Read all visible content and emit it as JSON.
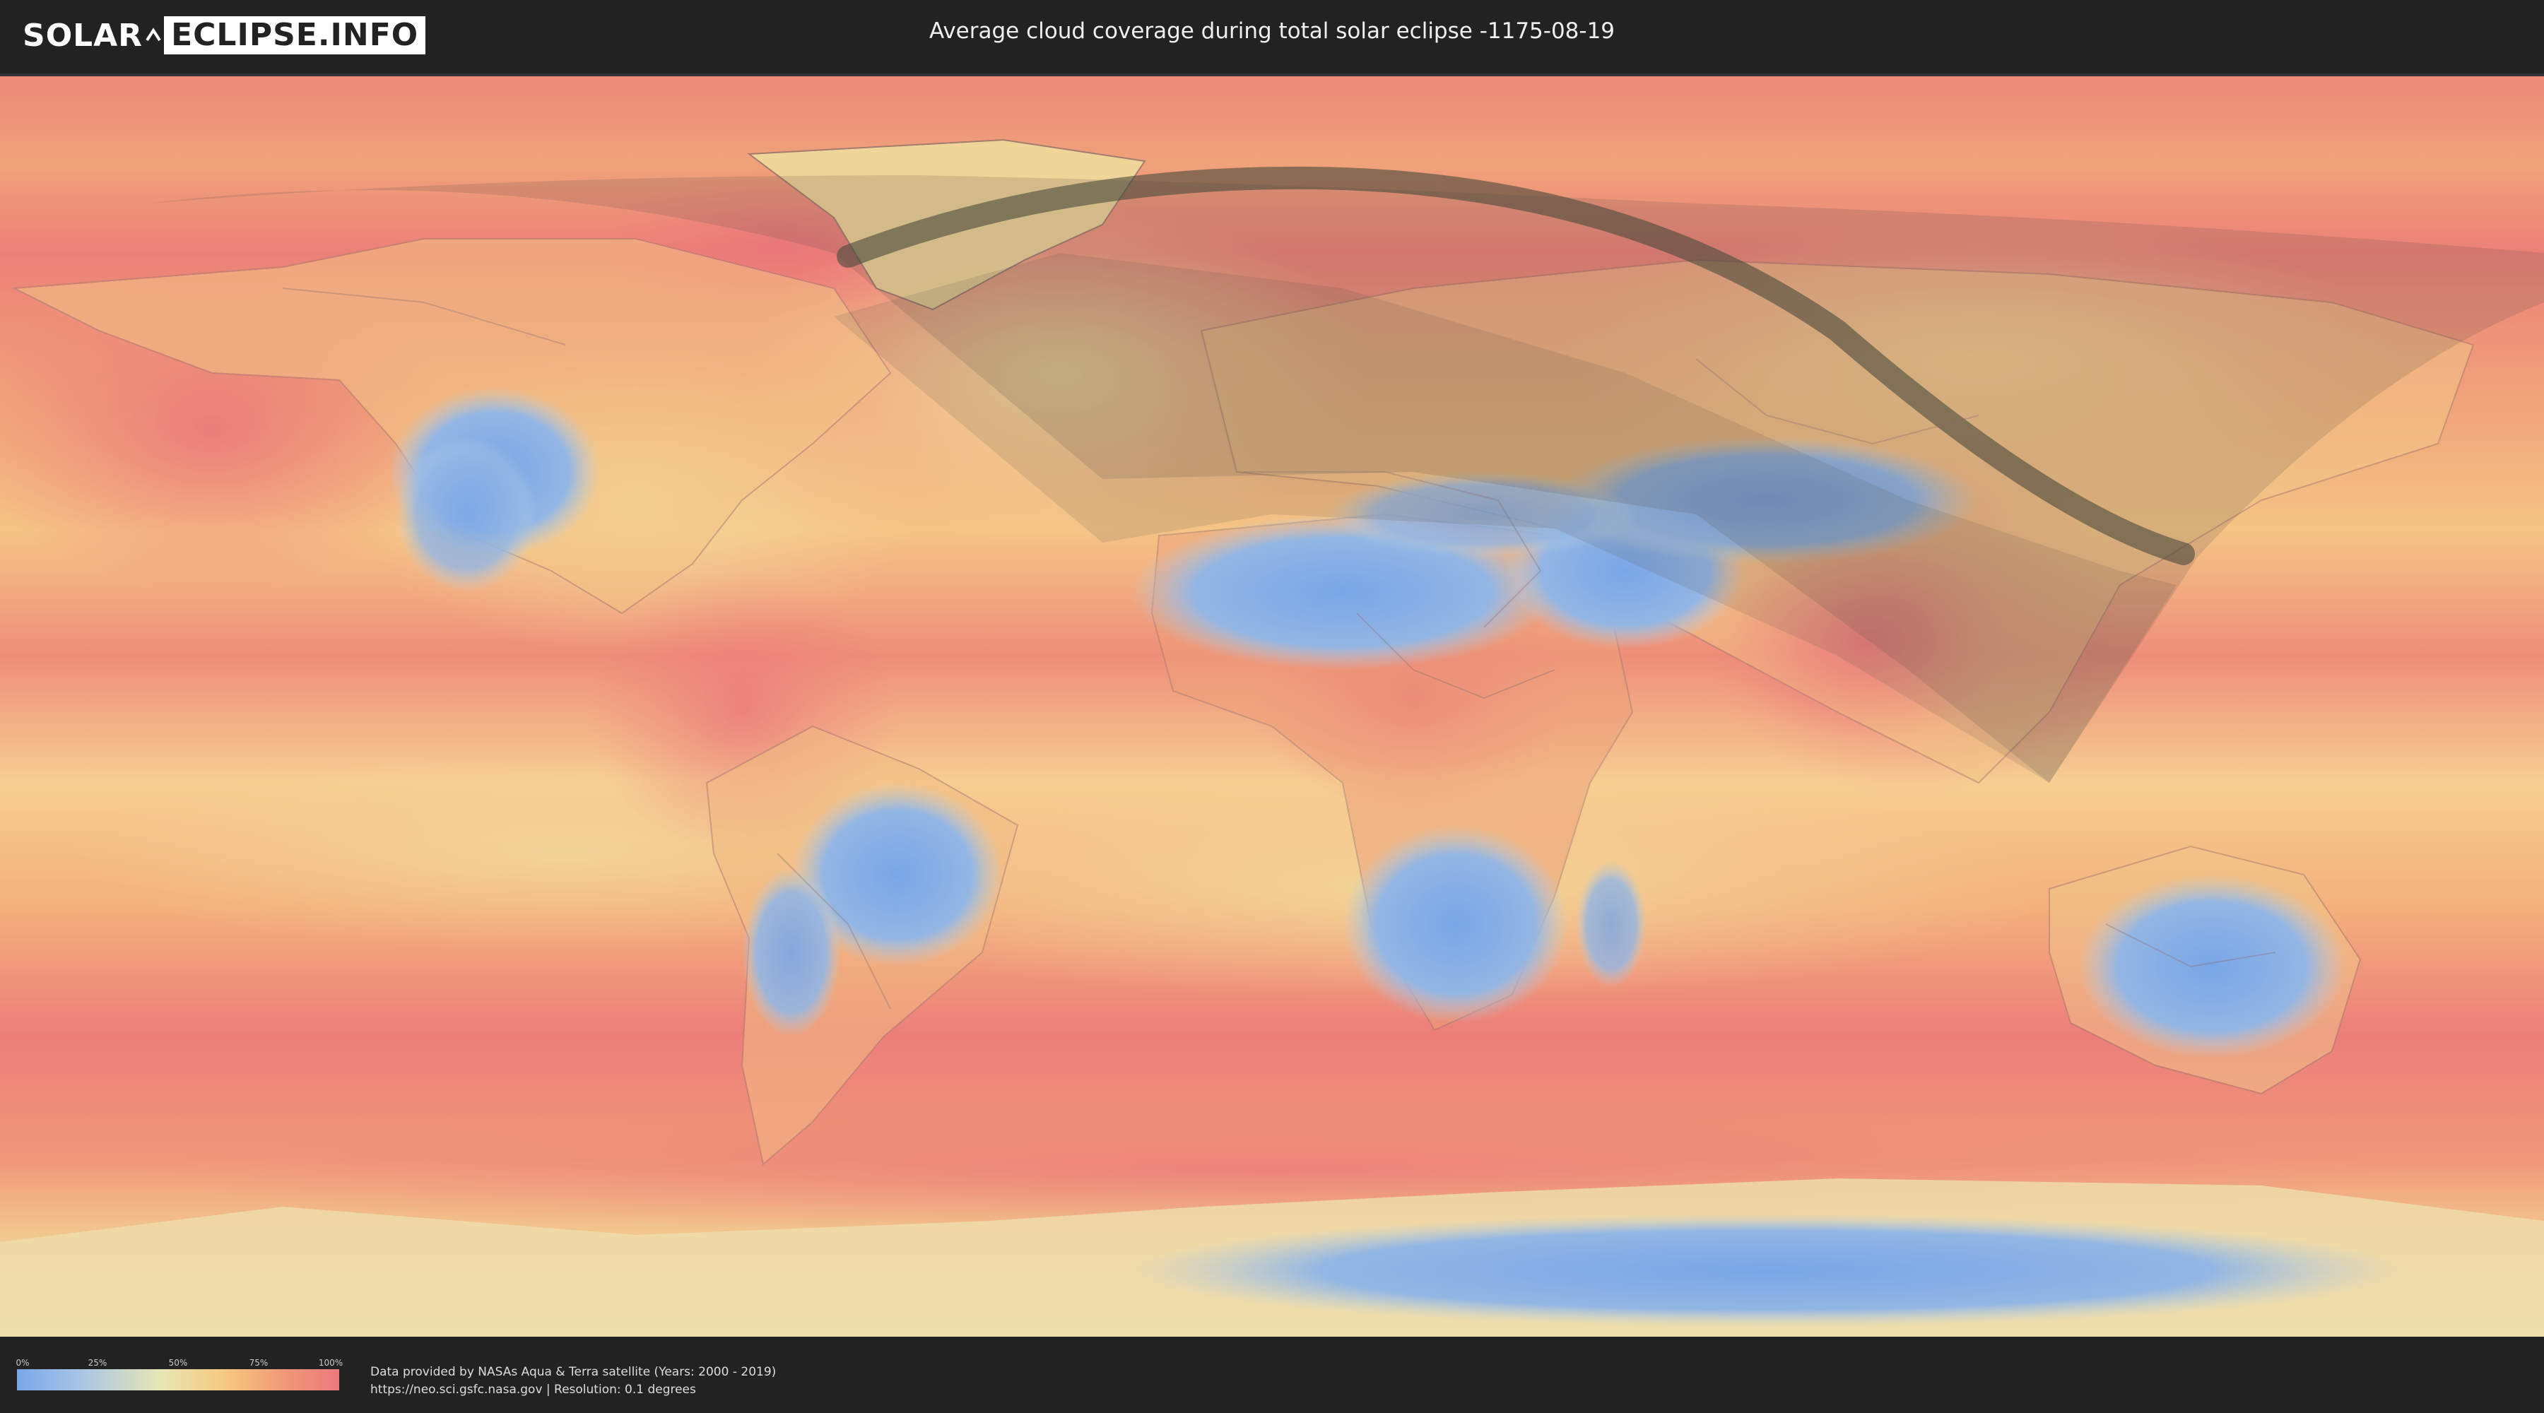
{
  "header": {
    "logo_solar": "SOLAR",
    "logo_eclipse": "ECLIPSE.INFO",
    "title": "Average cloud coverage during total solar eclipse -1175-08-19"
  },
  "map": {
    "description_icon": "world-cloud-map",
    "colors": {
      "ocean_cloudy": "#ec7e7c",
      "ocean_mid": "#f4b27a",
      "clear": "#7ea8e6",
      "mid": "#eed79c",
      "shadow": "#505040"
    }
  },
  "legend": {
    "ticks": [
      "0%",
      "25%",
      "50%",
      "75%",
      "100%"
    ]
  },
  "footer": {
    "credit_line1": "Data provided by NASAs Aqua & Terra satellite (Years: 2000 - 2019)",
    "credit_line2": "https://neo.sci.gsfc.nasa.gov | Resolution: 0.1 degrees"
  }
}
